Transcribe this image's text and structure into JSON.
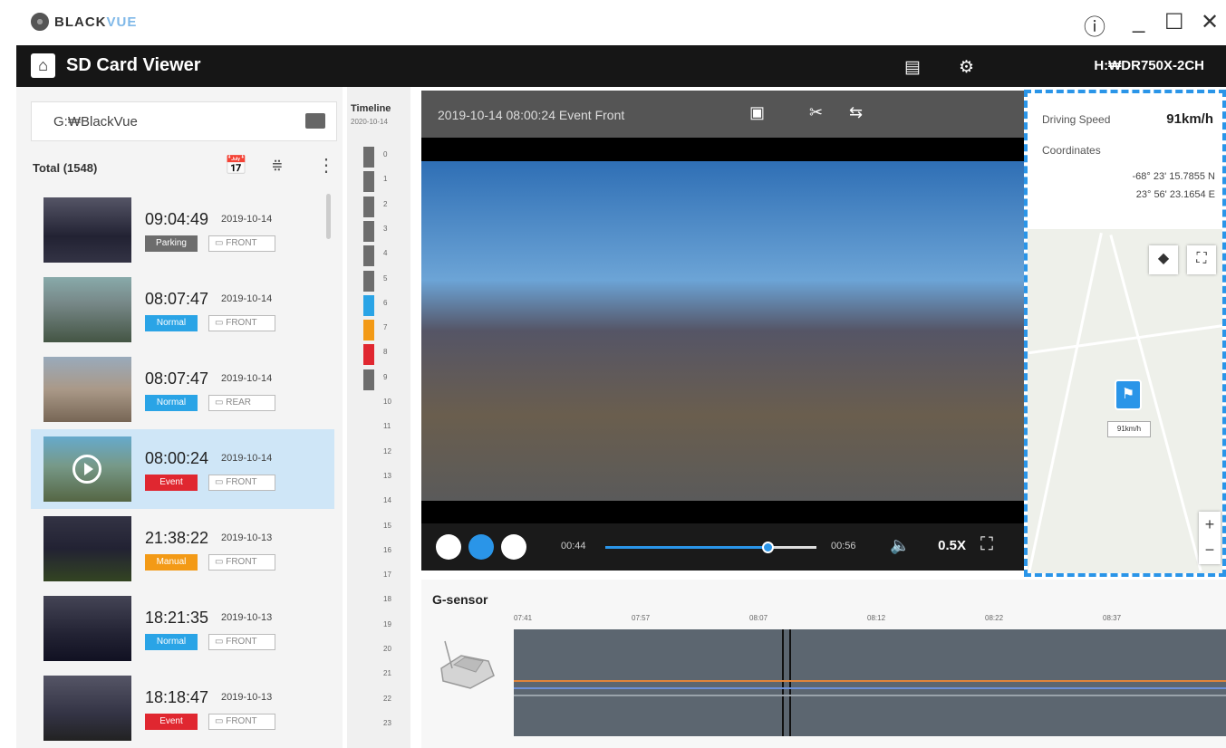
{
  "window": {
    "brand_part1": "BLACK",
    "brand_part2": "VUE",
    "info_icon": "ⓘ",
    "minimize_icon": "_",
    "maximize_icon": "☐",
    "close_icon": "✕"
  },
  "appbar": {
    "title": "SD Card Viewer",
    "device": "H:₩DR750X-2CH",
    "sd_icon": "▤",
    "settings_icon": "⚙",
    "home_icon": "⌂"
  },
  "sidebar": {
    "folder_path": "G:₩BlackVue",
    "total_label": "Total (1548)",
    "calendar_icon": "📅",
    "filter_icon": "⩷",
    "more_icon": "⋮",
    "items": [
      {
        "time": "09:04:49",
        "date": "2019-10-14",
        "type": "Parking",
        "color": "#6d6d6d",
        "camera": "FRONT"
      },
      {
        "time": "08:07:47",
        "date": "2019-10-14",
        "type": "Normal",
        "color": "#2aa4e6",
        "camera": "FRONT"
      },
      {
        "time": "08:07:47",
        "date": "2019-10-14",
        "type": "Normal",
        "color": "#2aa4e6",
        "camera": "REAR"
      },
      {
        "time": "08:00:24",
        "date": "2019-10-14",
        "type": "Event",
        "color": "#e02730",
        "camera": "FRONT"
      },
      {
        "time": "21:38:22",
        "date": "2019-10-13",
        "type": "Manual",
        "color": "#f39a16",
        "camera": "FRONT"
      },
      {
        "time": "18:21:35",
        "date": "2019-10-13",
        "type": "Normal",
        "color": "#2aa4e6",
        "camera": "FRONT"
      },
      {
        "time": "18:18:47",
        "date": "2019-10-13",
        "type": "Event",
        "color": "#e02730",
        "camera": "FRONT"
      }
    ]
  },
  "timeline": {
    "label": "Timeline",
    "date": "2020-10-14",
    "hours": [
      "0",
      "1",
      "2",
      "3",
      "4",
      "5",
      "6",
      "7",
      "8",
      "9",
      "10",
      "11",
      "12",
      "13",
      "14",
      "15",
      "16",
      "17",
      "18",
      "19",
      "20",
      "21",
      "22",
      "23"
    ],
    "bars": [
      "#6d6d6d",
      "#6d6d6d",
      "#6d6d6d",
      "#6d6d6d",
      "#6d6d6d",
      "#6d6d6d",
      "#2aa4e6",
      "#f39a16",
      "#e02730",
      "#6d6d6d"
    ]
  },
  "player": {
    "title": "2019-10-14 08:00:24 Event Front",
    "current_time": "00:44",
    "total_time": "00:56",
    "progress": 0.77,
    "speed": "0.5X",
    "snapshot_icon": "▣",
    "crop_icon": "✂",
    "mute_icon": "⇆",
    "volume_icon": "🔈",
    "fullscreen_icon": "⛶",
    "prev_icon": "⏮",
    "pause_icon": "⏸",
    "next_icon": "⏭"
  },
  "gsensor": {
    "label": "G-sensor",
    "ticks": [
      "07:41",
      "07:57",
      "08:07",
      "08:12",
      "08:22",
      "08:37"
    ],
    "lines": [
      "#e0843a",
      "#6c8fd6",
      "#9aa3ab"
    ]
  },
  "info": {
    "speed_label": "Driving Speed",
    "speed_value": "91km/h",
    "coord_label": "Coordinates",
    "latitude": "-68° 23' 15.7855 N",
    "longitude": "23° 56' 23.1654 E",
    "layers_icon": "◆",
    "expand_icon": "⛶",
    "zoom_in": "+",
    "zoom_out": "−",
    "pin_icon": "⚑",
    "pin_label": "91km/h"
  }
}
